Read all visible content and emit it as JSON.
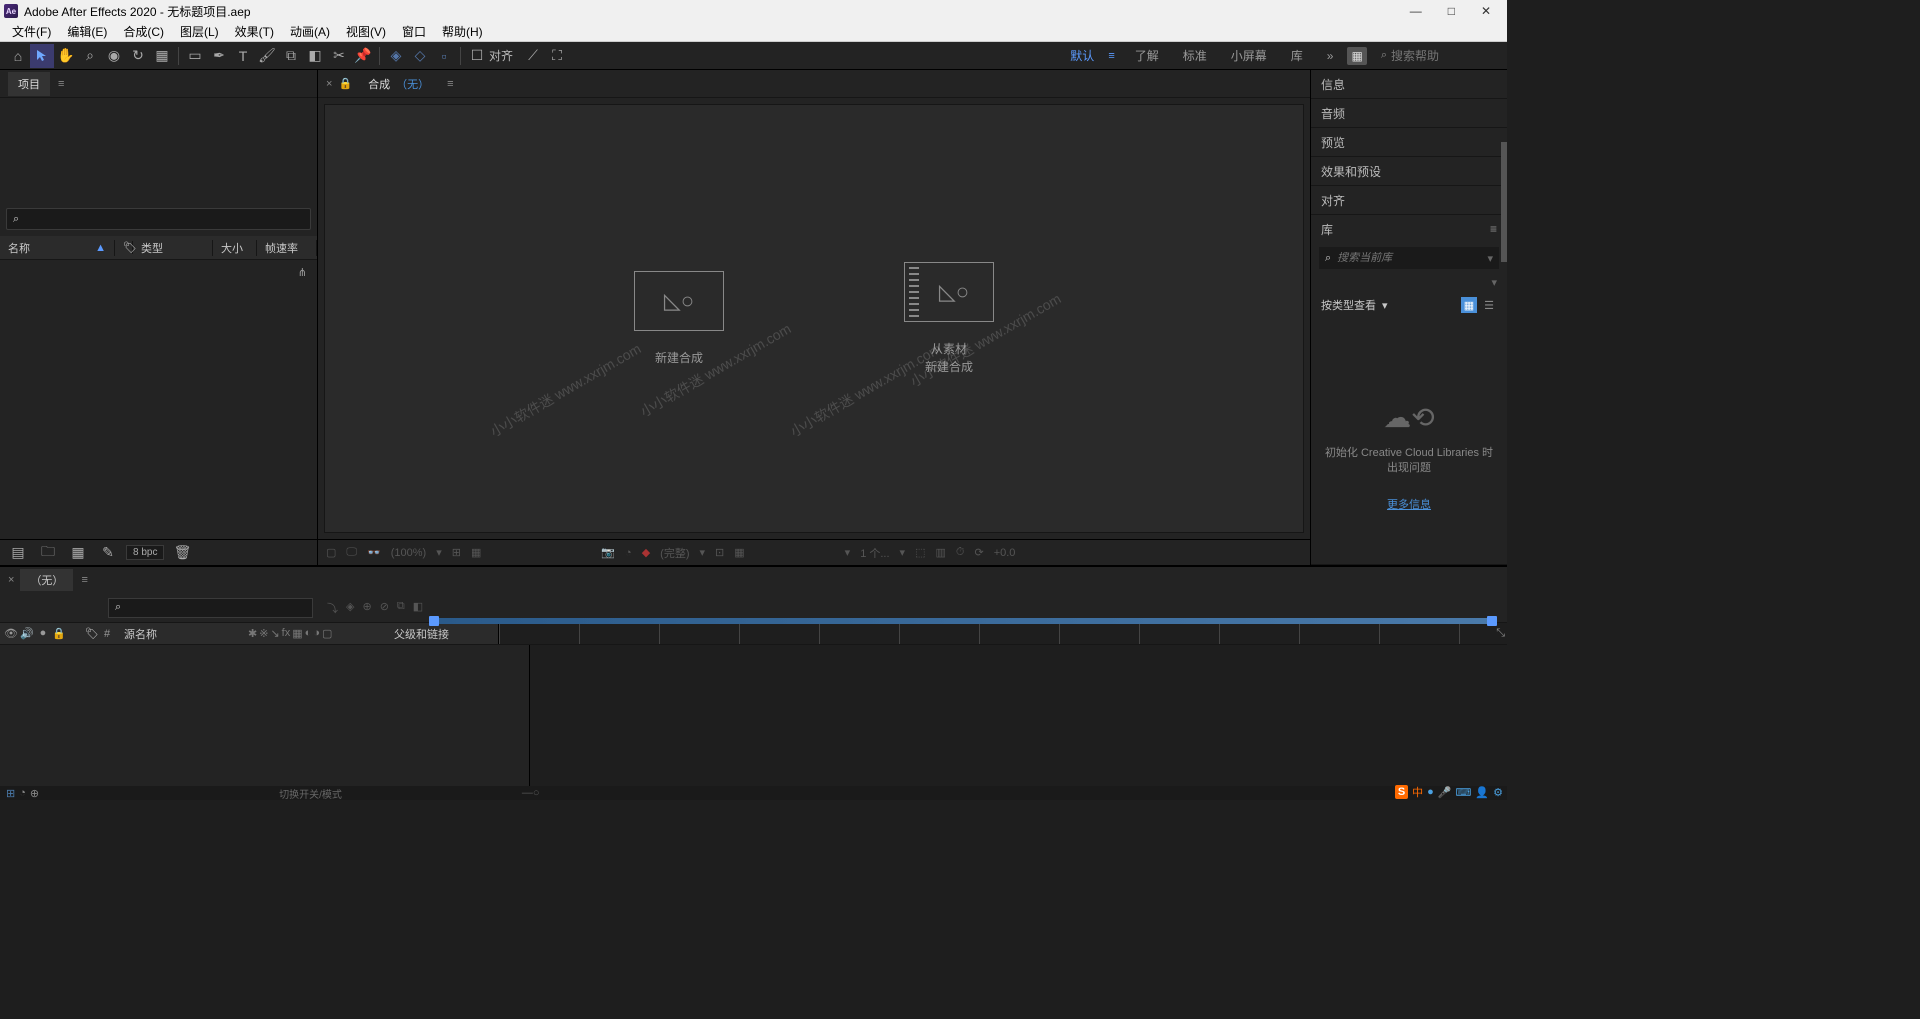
{
  "titlebar": {
    "app_icon": "Ae",
    "title": "Adobe After Effects 2020 - 无标题项目.aep"
  },
  "menu": [
    "文件(F)",
    "编辑(E)",
    "合成(C)",
    "图层(L)",
    "效果(T)",
    "动画(A)",
    "视图(V)",
    "窗口",
    "帮助(H)"
  ],
  "toolbar": {
    "align_label": "对齐",
    "workspaces": [
      "默认",
      "了解",
      "标准",
      "小屏幕",
      "库"
    ],
    "active_ws_index": 0,
    "search_placeholder": "搜索帮助"
  },
  "project_panel": {
    "tab": "项目",
    "search_icon": "⌕",
    "columns": {
      "name": "名称",
      "type": "类型",
      "size": "大小",
      "fps": "帧速率"
    },
    "bpc": "8 bpc"
  },
  "comp_panel": {
    "tab_prefix": "合成",
    "tab_link": "（无）",
    "new_comp": "新建合成",
    "new_from_footage_l1": "从素材",
    "new_from_footage_l2": "新建合成",
    "zoom": "(100%)",
    "quality": "(完整)",
    "camera_info": "1 个...",
    "exposure": "+0.0"
  },
  "right_panels": {
    "info": "信息",
    "audio": "音频",
    "preview": "预览",
    "effects": "效果和预设",
    "align": "对齐",
    "library": "库",
    "lib_search_placeholder": "搜索当前库",
    "lib_filter_label": "按类型查看",
    "lib_error": "初始化 Creative Cloud Libraries 时出现问题",
    "lib_link": "更多信息"
  },
  "timeline": {
    "tab": "（无）",
    "search_icon": "⌕",
    "cols": {
      "source_name": "源名称",
      "parent_link": "父级和链接"
    },
    "footer_hint": "切换开关/模式"
  },
  "watermark": "小小软件迷 www.xxrjm.com",
  "tray_icon_color_orange": "orange"
}
